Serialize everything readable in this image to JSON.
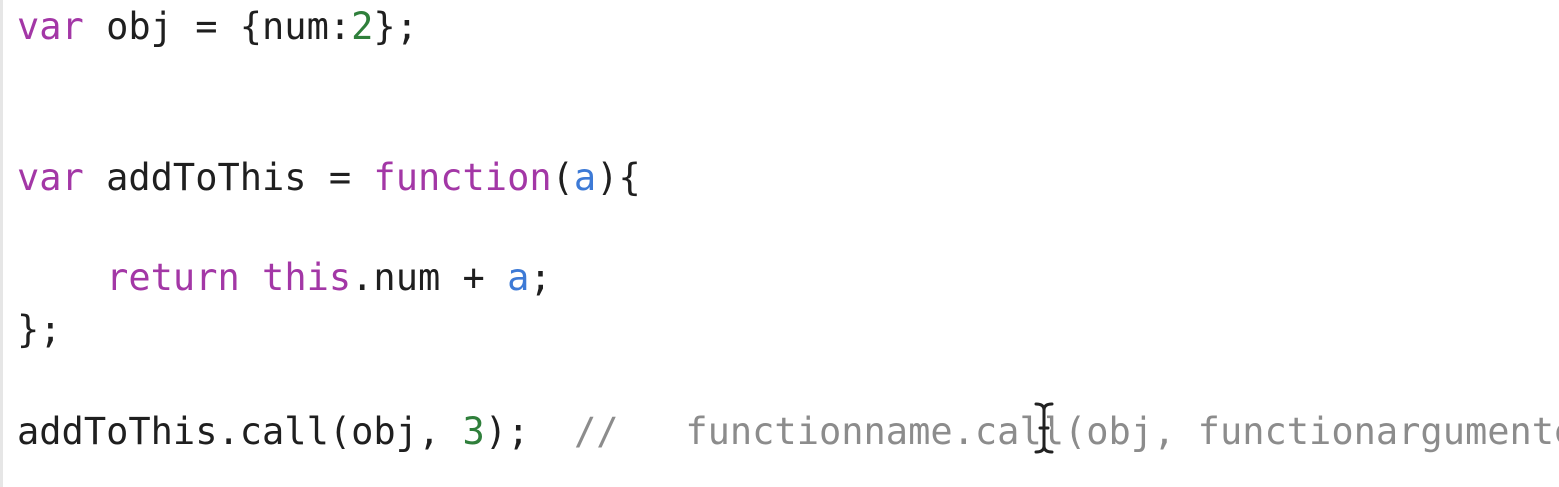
{
  "code": {
    "line1": {
      "kw": "var",
      "rest": " obj = {num:",
      "num": "2",
      "end": "};"
    },
    "line2": {
      "kw": "var",
      "rest": " addToThis = ",
      "kw2": "function",
      "open": "(",
      "param": "a",
      "close": "){"
    },
    "line3": {
      "indent": "    ",
      "kw": "return",
      "sp": " ",
      "kw2": "this",
      "rest": ".num + ",
      "param": "a",
      "end": ";"
    },
    "line4": {
      "text": "};"
    },
    "line5": {
      "code": "addToThis.call(obj, ",
      "num": "3",
      "end": ");",
      "gap": "  ",
      "comment": "//   functionname.call(obj, functionargumentes)"
    }
  },
  "icons": {
    "cursor": "text-cursor-icon"
  },
  "colors": {
    "keyword": "#a337a6",
    "parameter": "#3d7ad6",
    "number": "#2f7f3b",
    "comment": "#8c8c8c",
    "text": "#1f1f1f",
    "background": "#ffffff"
  }
}
